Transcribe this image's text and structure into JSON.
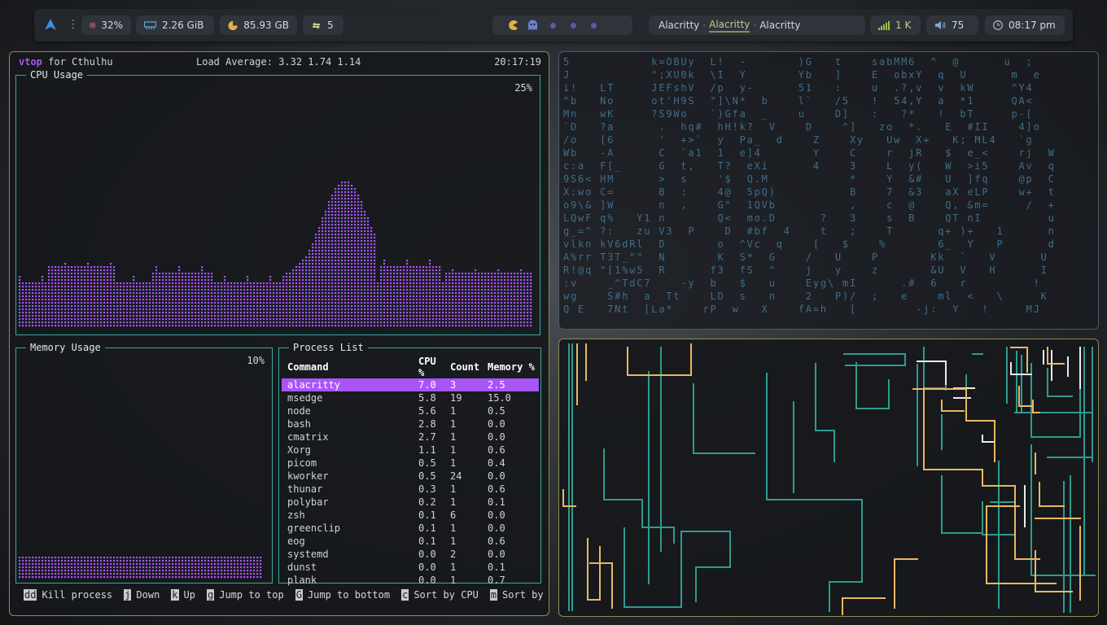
{
  "topbar": {
    "cpu": "32%",
    "ram": "2.26 GiB",
    "disk": "85.93 GB",
    "updates": "5",
    "windows": [
      "Alacritty",
      "Alacritty",
      "Alacritty"
    ],
    "signal": "1 K",
    "volume": "75",
    "clock": "08:17 pm",
    "colors": {
      "accent": "#a855f7",
      "disk": "#e0b14a",
      "active_window": "#c9c78a"
    }
  },
  "vtop": {
    "app": "vtop",
    "for_label": "for Cthulhu",
    "load_average": "Load Average: 3.32 1.74 1.14",
    "time": "20:17:19",
    "cpu_title": "CPU Usage",
    "cpu_pct": "25%",
    "memory_title": "Memory Usage",
    "memory_pct": "10%",
    "process_title": "Process List",
    "columns": [
      "Command",
      "CPU %",
      "Count",
      "Memory %"
    ],
    "processes": [
      [
        "alacritty",
        "7.0",
        "3",
        "2.5"
      ],
      [
        "msedge",
        "5.8",
        "19",
        "15.0"
      ],
      [
        "node",
        "5.6",
        "1",
        "0.5"
      ],
      [
        "bash",
        "2.8",
        "1",
        "0.0"
      ],
      [
        "cmatrix",
        "2.7",
        "1",
        "0.0"
      ],
      [
        "Xorg",
        "1.1",
        "1",
        "0.6"
      ],
      [
        "picom",
        "0.5",
        "1",
        "0.4"
      ],
      [
        "kworker",
        "0.5",
        "24",
        "0.0"
      ],
      [
        "thunar",
        "0.3",
        "1",
        "0.6"
      ],
      [
        "polybar",
        "0.2",
        "1",
        "0.1"
      ],
      [
        "zsh",
        "0.1",
        "6",
        "0.0"
      ],
      [
        "greenclip",
        "0.1",
        "1",
        "0.0"
      ],
      [
        "eog",
        "0.1",
        "1",
        "0.6"
      ],
      [
        "systemd",
        "0.0",
        "2",
        "0.0"
      ],
      [
        "dunst",
        "0.0",
        "1",
        "0.1"
      ],
      [
        "plank",
        "0.0",
        "1",
        "0.7"
      ]
    ],
    "help": [
      {
        "key": "dd",
        "label": "Kill process"
      },
      {
        "key": "j",
        "label": "Down"
      },
      {
        "key": "k",
        "label": "Up"
      },
      {
        "key": "g",
        "label": "Jump to top"
      },
      {
        "key": "G",
        "label": "Jump to bottom"
      },
      {
        "key": "c",
        "label": "Sort by CPU"
      },
      {
        "key": "m",
        "label": "Sort by"
      }
    ]
  },
  "cmatrix_rows": [
    "5           k=OBUy  L!  -       )G   t    sabMM6  ^  @      u  ;",
    "J           \";XU0k  \\I  Y       Yb   ]    E  obxY  q  U      m  e",
    "i!   LT     JEFshV  /p  y-      51   :    u  .?,v  v  kW     ^Y4",
    "^b   No     ot'H9S  \"]\\N*  b    l`   /5   !  54,Y  a  *1     QA<",
    "Mn   wK     ?S9Wo   `)Gfa  _    u    D]   :   ?*   !  bT     p-[",
    "`D   ?a      .  hq#  hH!k?  V    D    ^]   zo  *.   E  #II    4]o",
    "/o   [6      '  +>`  y  Pa_  d    Z    Xy   Uw  X+   K; ML4   `g",
    "Wb   -A      C  `a1  1  e]4       Y    C    r  jR   $  e_<    rj  W",
    "c:a  F[_     G  t,   T?  eXi      4    3    L  y(   W  >i5    Av  q",
    "9S6< HM      >  s    '$  Q.M           *    Y  &#   U  ]fq    @p  C",
    "X:wo C=      B  :    4@  5pQ)          B    7  &3   aX eLP    w+  t",
    "o9\\& ]W      n  ,    G\"  1QVb          ,    c  @    Q, &m=     /  +",
    "LQwF q%   Y1 n       Q<  mo.D      ?   3    s  B    QT nI         u",
    "g_=^ ?:   zu V3  P    D  #bf  4    t   ;    T      q+ )+   1      n",
    "vlkn kV6dRl  D       o  ^Vc  q    [   $    %       6_  Y   P      d",
    "A%rr T3T_\"\"  N       K  S*  G    /   U    P       Kk  `   V      U",
    "R!@q \"[1%w5  R      f3  fS  ^    j   y    z       &U  V   H      I",
    ":v    _^TdC7    -y  b   $   u    Eyg\\ mI      .#  6   r         !",
    "wg    S#h  a  Tt    LD  s   n    2   P)/  ;   e    ml  <   \\     K",
    "Q E   7Nt  [La*    rP  w   X    fA=h   [        -j:  Y   !     MJ"
  ]
}
